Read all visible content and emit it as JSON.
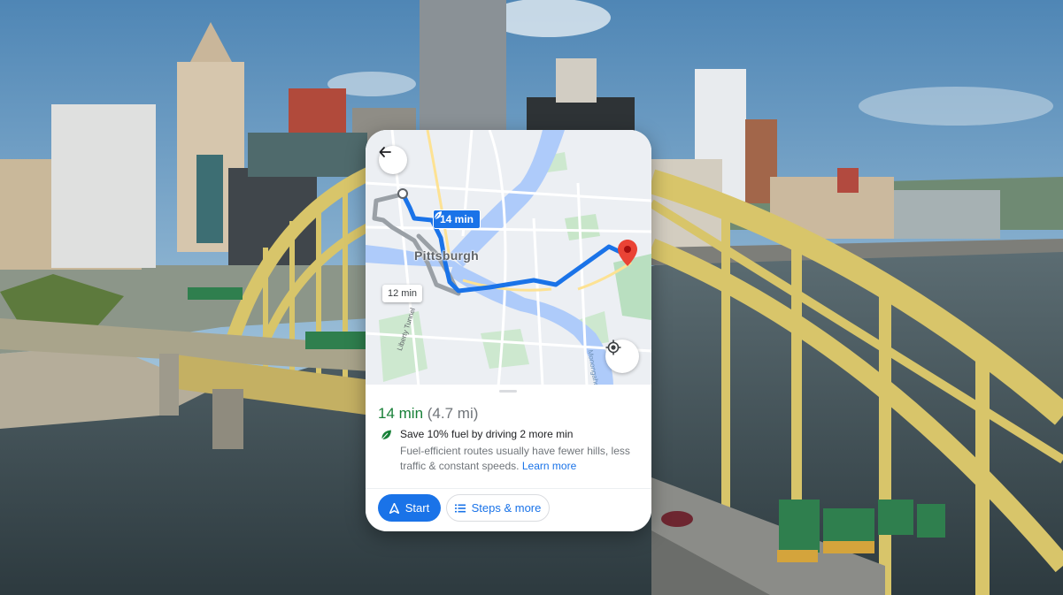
{
  "map": {
    "city_label": "Pittsburgh",
    "route_badge_time": "14 min",
    "alt_route_time": "12 min",
    "tunnel_label": "Liberty Tunnel",
    "river_label": "Monongahela"
  },
  "route": {
    "duration": "14 min",
    "distance": "(4.7 mi)",
    "save_message": "Save 10% fuel by driving 2 more min",
    "description": "Fuel-efficient routes usually have fewer hills, less traffic & constant speeds.",
    "learn_more": "Learn more"
  },
  "actions": {
    "start_label": "Start",
    "steps_label": "Steps & more"
  },
  "colors": {
    "accent_blue": "#1a73e8",
    "eco_green": "#188038",
    "bridge_yellow": "#d9c66d",
    "river": "#3e4a4f"
  },
  "icons": {
    "back": "arrow-left-icon",
    "locate": "my-location-icon",
    "leaf": "leaf-icon",
    "navigate": "navigation-arrow-icon",
    "steps": "list-icon",
    "destination": "map-pin-icon"
  }
}
